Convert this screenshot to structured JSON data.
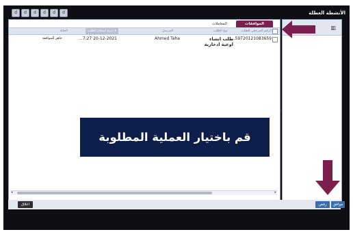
{
  "window": {
    "title": "الأنشطة العطلة",
    "controls": [
      "d",
      "d",
      "d",
      "d",
      "d",
      "d"
    ]
  },
  "tabs": [
    {
      "label": "الموافقات المعلقة",
      "active": true
    },
    {
      "label": "المعاملات المرفوضة",
      "active": false
    }
  ],
  "grid": {
    "headers": {
      "ref": "الرقم المرجعي للطلب",
      "type": "نوع الطلب",
      "from": "المرسل",
      "date": "تاريخ استلام الطلب",
      "status": "الحالة"
    },
    "rows": [
      {
        "ref": "...59720121083659",
        "type": "طلب انشاء اوعية ادخارية",
        "from": "Ahmed Taha",
        "date": "...7:27 20-12-2021",
        "status": "جاهز للموافقة"
      }
    ]
  },
  "buttons": {
    "approve": "موافق",
    "reject": "رفض",
    "close": "اغلاق"
  },
  "overlay": {
    "banner_text": "قم باختيار العملية المطلوبة",
    "arrow_color": "#7c1e4e",
    "banner_color": "#0e1e4b"
  },
  "icons": {
    "right_panel": "book-icon"
  }
}
